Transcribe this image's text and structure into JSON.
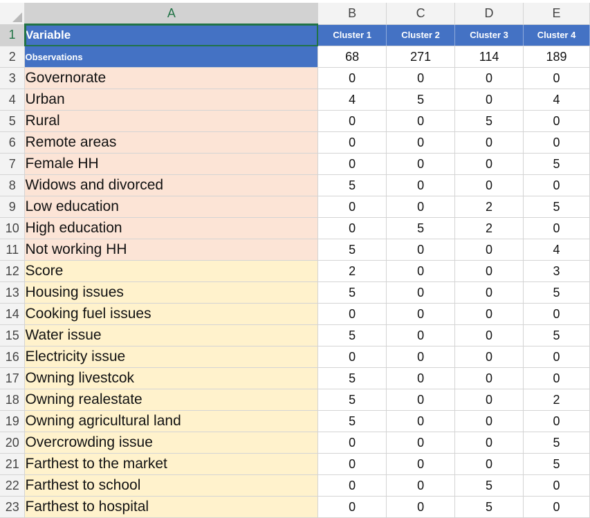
{
  "sheet": {
    "column_headers": [
      "A",
      "B",
      "C",
      "D",
      "E"
    ],
    "selected_cell": "A1",
    "colors": {
      "header_blue": "#4472c4",
      "peach": "#fce4d6",
      "cream": "#fff2cc",
      "selection_green": "#217346"
    },
    "header": {
      "row_number": "1",
      "variable_label": "Variable",
      "clusters": [
        "Cluster 1",
        "Cluster 2",
        "Cluster 3",
        "Cluster 4"
      ]
    },
    "observations": {
      "row_number": "2",
      "label": "Observations",
      "values": [
        "68",
        "271",
        "114",
        "189"
      ]
    },
    "rows": [
      {
        "row_number": "3",
        "variable": "Governorate",
        "values": [
          "0",
          "0",
          "0",
          "0"
        ],
        "fill": "peach"
      },
      {
        "row_number": "4",
        "variable": "Urban",
        "values": [
          "4",
          "5",
          "0",
          "4"
        ],
        "fill": "peach"
      },
      {
        "row_number": "5",
        "variable": "Rural",
        "values": [
          "0",
          "0",
          "5",
          "0"
        ],
        "fill": "peach"
      },
      {
        "row_number": "6",
        "variable": "Remote areas",
        "values": [
          "0",
          "0",
          "0",
          "0"
        ],
        "fill": "peach"
      },
      {
        "row_number": "7",
        "variable": "Female HH",
        "values": [
          "0",
          "0",
          "0",
          "5"
        ],
        "fill": "peach"
      },
      {
        "row_number": "8",
        "variable": "Widows and divorced",
        "values": [
          "5",
          "0",
          "0",
          "0"
        ],
        "fill": "peach"
      },
      {
        "row_number": "9",
        "variable": "Low education",
        "values": [
          "0",
          "0",
          "2",
          "5"
        ],
        "fill": "peach"
      },
      {
        "row_number": "10",
        "variable": "High education",
        "values": [
          "0",
          "5",
          "2",
          "0"
        ],
        "fill": "peach"
      },
      {
        "row_number": "11",
        "variable": "Not working HH",
        "values": [
          "5",
          "0",
          "0",
          "4"
        ],
        "fill": "peach"
      },
      {
        "row_number": "12",
        "variable": "Score",
        "values": [
          "2",
          "0",
          "0",
          "3"
        ],
        "fill": "cream"
      },
      {
        "row_number": "13",
        "variable": "Housing issues",
        "values": [
          "5",
          "0",
          "0",
          "5"
        ],
        "fill": "cream"
      },
      {
        "row_number": "14",
        "variable": "Cooking fuel issues",
        "values": [
          "0",
          "0",
          "0",
          "0"
        ],
        "fill": "cream"
      },
      {
        "row_number": "15",
        "variable": "Water issue",
        "values": [
          "5",
          "0",
          "0",
          "5"
        ],
        "fill": "cream"
      },
      {
        "row_number": "16",
        "variable": "Electricity issue",
        "values": [
          "0",
          "0",
          "0",
          "0"
        ],
        "fill": "cream"
      },
      {
        "row_number": "17",
        "variable": "Owning livestcok",
        "values": [
          "5",
          "0",
          "0",
          "0"
        ],
        "fill": "cream"
      },
      {
        "row_number": "18",
        "variable": "Owning realestate",
        "values": [
          "5",
          "0",
          "0",
          "2"
        ],
        "fill": "cream"
      },
      {
        "row_number": "19",
        "variable": "Owning agricultural land",
        "values": [
          "5",
          "0",
          "0",
          "0"
        ],
        "fill": "cream"
      },
      {
        "row_number": "20",
        "variable": "Overcrowding issue",
        "values": [
          "0",
          "0",
          "0",
          "5"
        ],
        "fill": "cream"
      },
      {
        "row_number": "21",
        "variable": "Farthest to the market",
        "values": [
          "0",
          "0",
          "0",
          "5"
        ],
        "fill": "cream"
      },
      {
        "row_number": "22",
        "variable": "Farthest to school",
        "values": [
          "0",
          "0",
          "5",
          "0"
        ],
        "fill": "cream"
      },
      {
        "row_number": "23",
        "variable": "Farthest to hospital",
        "values": [
          "0",
          "0",
          "5",
          "0"
        ],
        "fill": "cream"
      }
    ]
  }
}
